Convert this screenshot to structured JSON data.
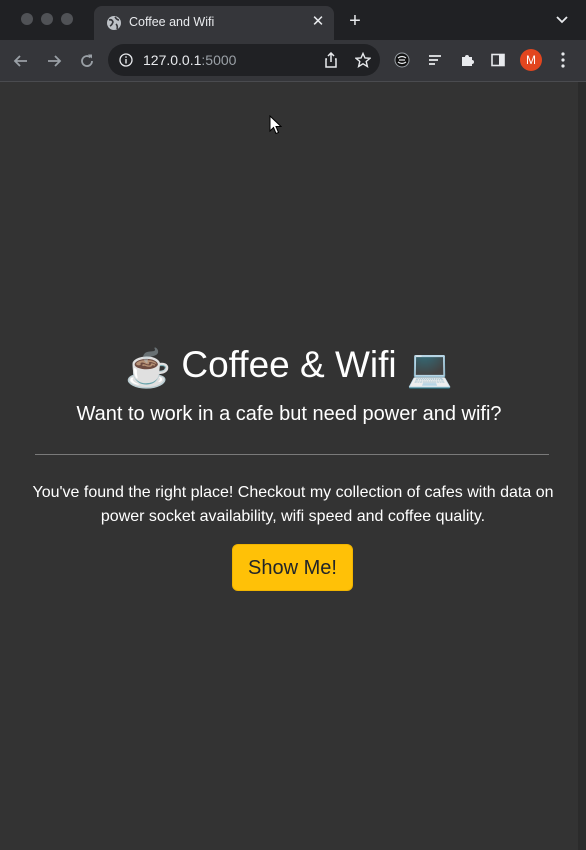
{
  "browser": {
    "tab": {
      "title": "Coffee and Wifi",
      "close_glyph": "✕"
    },
    "new_tab_glyph": "+",
    "address": {
      "host": "127.0.0.1",
      "port": ":5000"
    },
    "profile_initial": "M",
    "icons": [
      "globe-icon",
      "close-icon",
      "plus-icon",
      "chevron-down-icon",
      "back-arrow-icon",
      "forward-arrow-icon",
      "reload-icon",
      "info-icon",
      "share-icon",
      "star-icon",
      "extension-shield-icon",
      "reading-list-icon",
      "puzzle-icon",
      "side-panel-icon",
      "kebab-menu-icon"
    ]
  },
  "page": {
    "title": {
      "emoji_left": "☕",
      "text": "Coffee & Wifi",
      "emoji_right": "💻"
    },
    "lead": "Want to work in a cafe but need power and wifi?",
    "body": "You've found the right place! Checkout my collection of cafes with data on power socket availability, wifi speed and coffee quality.",
    "button_label": "Show Me!"
  },
  "colors": {
    "page_bg": "#333333",
    "button_bg": "#ffc107",
    "avatar_bg": "#e2461f"
  }
}
